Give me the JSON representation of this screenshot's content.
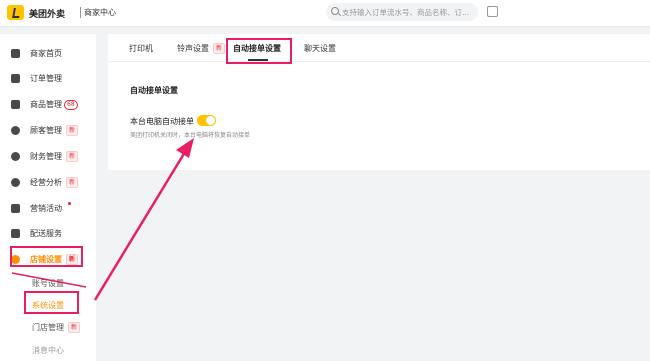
{
  "header": {
    "brand": "美团外卖",
    "subtitle": "商家中心",
    "search_placeholder": "支持输入订单流水号、商品名称、订..."
  },
  "sidebar": {
    "items": [
      {
        "label": "商家首页",
        "icon": "home-grid-icon"
      },
      {
        "label": "订单管理",
        "icon": "order-icon"
      },
      {
        "label": "商品管理",
        "icon": "product-icon",
        "badge": "68"
      },
      {
        "label": "顾客管理",
        "icon": "customer-icon",
        "badge": "新"
      },
      {
        "label": "财务管理",
        "icon": "finance-icon",
        "badge": "新"
      },
      {
        "label": "经营分析",
        "icon": "analysis-icon",
        "badge": "新"
      },
      {
        "label": "营销活动",
        "icon": "marketing-icon",
        "dot": true
      },
      {
        "label": "配送服务",
        "icon": "delivery-icon"
      },
      {
        "label": "店铺设置",
        "icon": "store-settings-icon",
        "badge": "新",
        "active": true
      }
    ],
    "sub_items": [
      {
        "label": "账号设置"
      },
      {
        "label": "系统设置",
        "active": true
      },
      {
        "label": "门店管理",
        "badge": "新"
      },
      {
        "label": "消息中心"
      }
    ]
  },
  "tabs": [
    {
      "label": "打印机"
    },
    {
      "label": "铃声设置",
      "badge": "新"
    },
    {
      "label": "自动接单设置",
      "active": true
    },
    {
      "label": "聊天设置"
    }
  ],
  "settings": {
    "section_title": "自动接单设置",
    "label": "本台电脑自动接单",
    "description": "美团打印机关闭时，本台电脑将恢复自动接单",
    "enabled": true
  },
  "colors": {
    "accent": "#ffc300",
    "active_text": "#ff8f00",
    "annotation": "#e91e63",
    "badge_red": "#f5222d"
  }
}
